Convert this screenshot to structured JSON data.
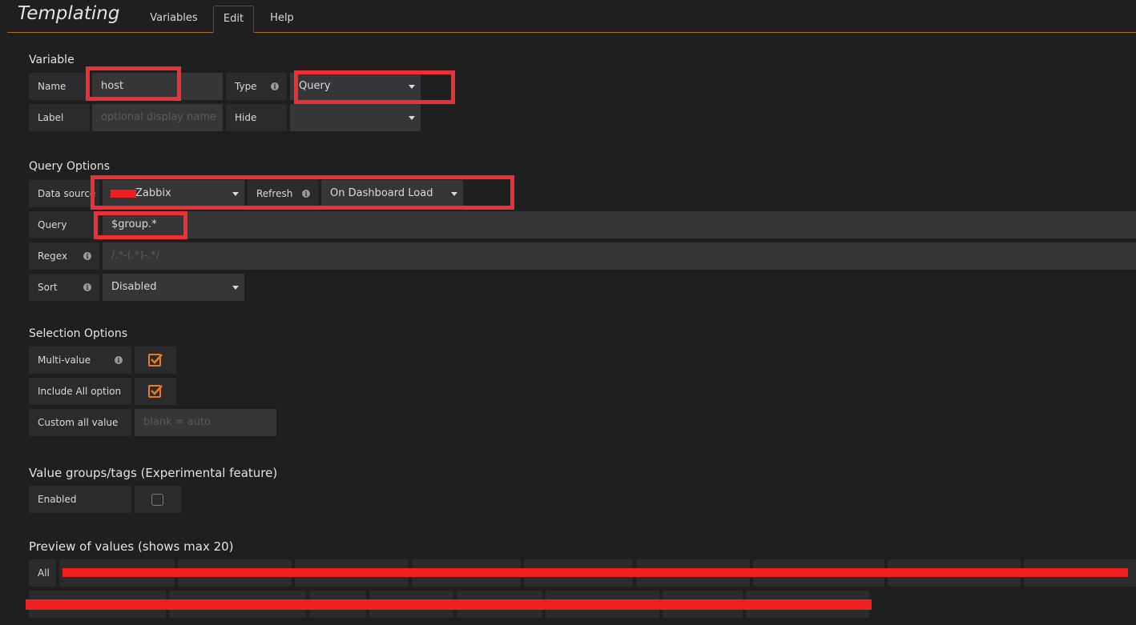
{
  "header": {
    "title": "Templating",
    "tabs": [
      "Variables",
      "Edit",
      "Help"
    ]
  },
  "variable": {
    "section_title": "Variable",
    "name_label": "Name",
    "name_value": "host",
    "type_label": "Type",
    "type_value": "Query",
    "label_label": "Label",
    "label_placeholder": "optional display name",
    "hide_label": "Hide",
    "hide_value": ""
  },
  "query_options": {
    "section_title": "Query Options",
    "datasource_label": "Data source",
    "datasource_value": "Zabbix",
    "refresh_label": "Refresh",
    "refresh_value": "On Dashboard Load",
    "query_label": "Query",
    "query_value": "$group.*",
    "regex_label": "Regex",
    "regex_placeholder": "/.*-(.*)-.*/",
    "sort_label": "Sort",
    "sort_value": "Disabled"
  },
  "selection_options": {
    "section_title": "Selection Options",
    "multi_label": "Multi-value",
    "multi_checked": true,
    "include_all_label": "Include All option",
    "include_all_checked": true,
    "custom_all_label": "Custom all value",
    "custom_all_placeholder": "blank = auto"
  },
  "value_groups": {
    "section_title": "Value groups/tags (Experimental feature)",
    "enabled_label": "Enabled",
    "enabled_checked": false
  },
  "preview": {
    "section_title": "Preview of values (shows max 20)",
    "first_value": "All"
  },
  "colors": {
    "accent": "#eb7b18",
    "annotation_red": "#ec3134",
    "background": "#1f1f20"
  }
}
